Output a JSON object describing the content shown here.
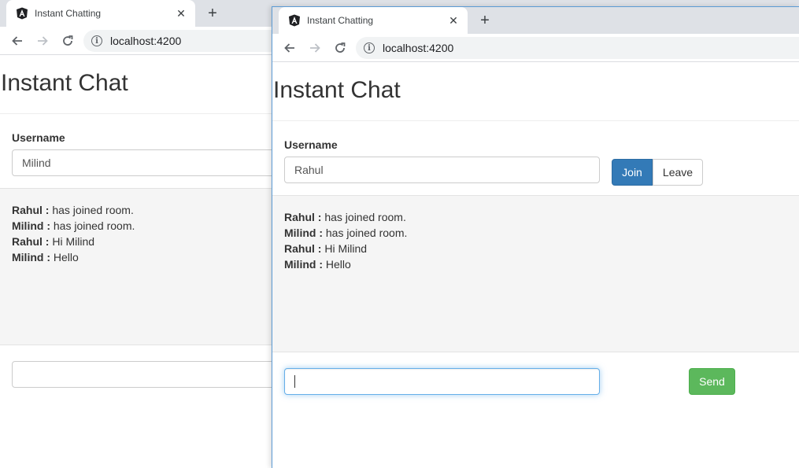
{
  "back_window": {
    "tab_title": "Instant Chatting",
    "url": "localhost:4200",
    "page_title": "Instant Chat",
    "username_label": "Username",
    "username_value": "Milind",
    "messages": [
      {
        "user": "Rahul :",
        "text": " has joined room."
      },
      {
        "user": "Milind :",
        "text": " has joined room."
      },
      {
        "user": "Rahul :",
        "text": " Hi Milind"
      },
      {
        "user": "Milind :",
        "text": " Hello"
      }
    ],
    "message_input_value": ""
  },
  "front_window": {
    "tab_title": "Instant Chatting",
    "url": "localhost:4200",
    "page_title": "Instant Chat",
    "username_label": "Username",
    "username_value": "Rahul",
    "join_label": "Join",
    "leave_label": "Leave",
    "messages": [
      {
        "user": "Rahul :",
        "text": " has joined room."
      },
      {
        "user": "Milind :",
        "text": " has joined room."
      },
      {
        "user": "Rahul :",
        "text": " Hi Milind"
      },
      {
        "user": "Milind :",
        "text": " Hello"
      }
    ],
    "message_input_value": "",
    "send_label": "Send"
  },
  "icons": {
    "favicon": "angular-icon",
    "close": "close-icon",
    "new_tab": "plus-icon",
    "back": "arrow-left-icon",
    "forward": "arrow-right-icon",
    "reload": "reload-icon",
    "site_info": "info-icon"
  },
  "colors": {
    "primary": "#337ab7",
    "success": "#5cb85c",
    "tabstrip": "#dee1e6",
    "well": "#f5f5f5",
    "focus_border": "#66afe9"
  }
}
